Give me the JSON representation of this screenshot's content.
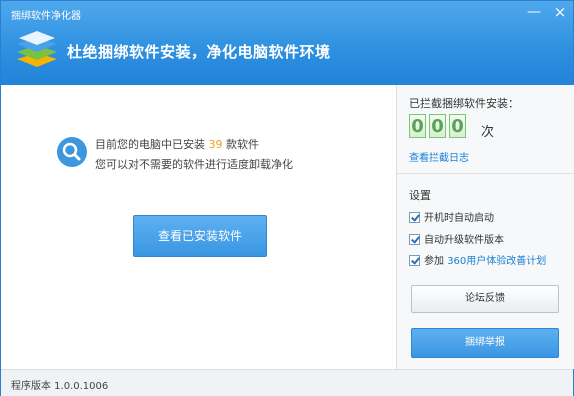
{
  "window": {
    "title": "捆绑软件净化器",
    "minimize_glyph": "—",
    "close_glyph": "×"
  },
  "header": {
    "slogan": "杜绝捆绑软件安装，净化电脑软件环境",
    "logo_icon": "layers-stack-icon"
  },
  "main": {
    "info_prefix": "目前您的电脑中已安装",
    "installed_count": "39",
    "info_suffix": "款软件",
    "info_line2": "您可以对不需要的软件进行适度卸载净化",
    "view_button": "查看已安装软件",
    "search_icon": "search-icon"
  },
  "side": {
    "blocked_title": "已拦截捆绑软件安装：",
    "blocked_digits": [
      "0",
      "0",
      "0"
    ],
    "times_unit": "次",
    "log_link": "查看拦截日志",
    "settings_title": "设置",
    "settings": [
      {
        "label": "开机时自动启动",
        "checked": true
      },
      {
        "label": "自动升级软件版本",
        "checked": true
      },
      {
        "label_prefix": "参加",
        "label_link": "360用户体验改善计划",
        "checked": true
      }
    ],
    "forum_button": "论坛反馈",
    "report_button": "捆绑举报"
  },
  "status": {
    "version": "程序版本 1.0.0.1006"
  },
  "colors": {
    "accent": "#2d8fe0",
    "count": "#f0a020",
    "digit_green": "#5aa25a",
    "link": "#1b80d6"
  }
}
